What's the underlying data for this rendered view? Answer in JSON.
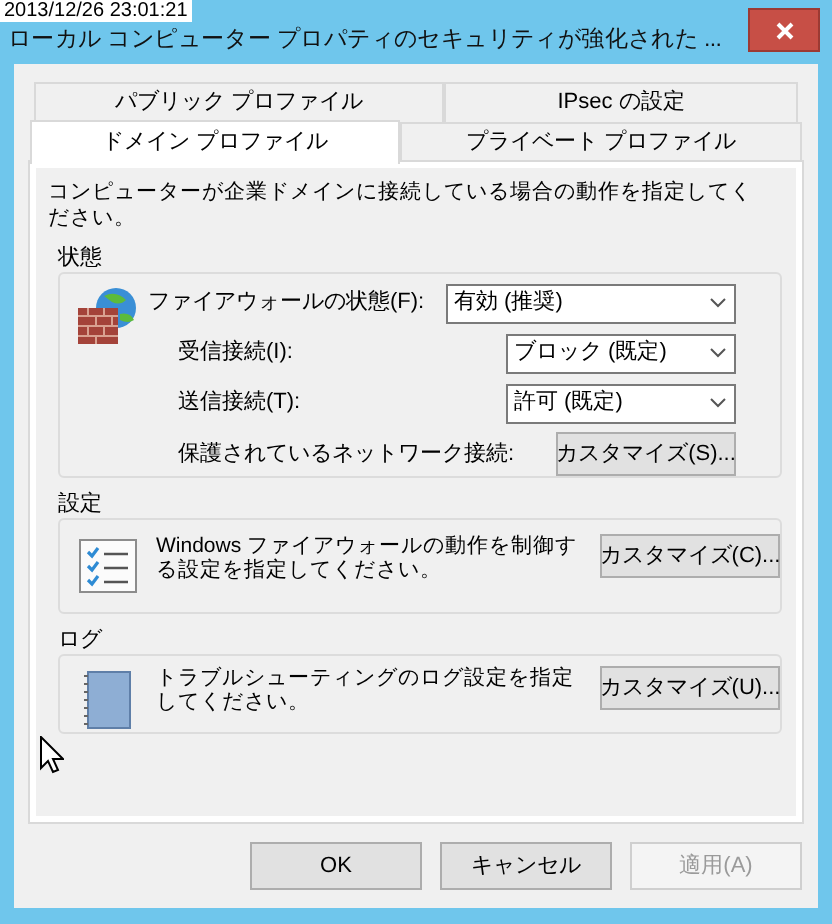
{
  "timestamp": "2013/12/26 23:01:21",
  "window": {
    "title": "ローカル コンピューター プロパティのセキュリティが強化された ..."
  },
  "tab_rows": [
    [
      {
        "label": "パブリック プロファイル",
        "selected": false
      },
      {
        "label": "IPsec の設定",
        "selected": false
      }
    ],
    [
      {
        "label": "ドメイン プロファイル",
        "selected": true
      },
      {
        "label": "プライベート プロファイル",
        "selected": false
      }
    ]
  ],
  "description": "コンピューターが企業ドメインに接続している場合の動作を指定してください。",
  "groups": [
    {
      "title": "状態",
      "kind": "status",
      "rows": [
        {
          "kind": "dropdown",
          "label": "ファイアウォールの状態(F):",
          "value": "有効 (推奨)"
        },
        {
          "kind": "dropdown",
          "label": "受信接続(I):",
          "value": "ブロック (既定)"
        },
        {
          "kind": "dropdown",
          "label": "送信接続(T):",
          "value": "許可 (既定)"
        },
        {
          "kind": "button",
          "label": "保護されているネットワーク接続:",
          "value": "カスタマイズ(S)..."
        }
      ]
    },
    {
      "title": "設定",
      "kind": "settings",
      "text": "Windows ファイアウォールの動作を制御する設定を指定してください。",
      "button": "カスタマイズ(C)..."
    },
    {
      "title": "ログ",
      "kind": "log",
      "text": "トラブルシューティングのログ設定を指定してください。",
      "button": "カスタマイズ(U)..."
    }
  ],
  "buttons": [
    {
      "label": "OK",
      "disabled": false
    },
    {
      "label": "キャンセル",
      "disabled": false
    },
    {
      "label": "適用(A)",
      "disabled": true
    }
  ]
}
